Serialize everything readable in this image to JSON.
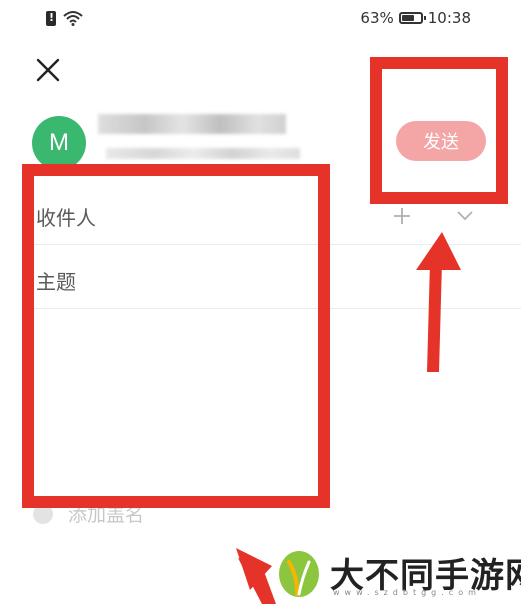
{
  "status_bar": {
    "battery_percent": "63%",
    "time": "10:38"
  },
  "compose": {
    "avatar_letter": "M",
    "send_label": "发送",
    "recipient_label": "收件人",
    "subject_label": "主题",
    "attach_label": "添加盖名"
  },
  "watermark": {
    "title": "大不同手游网",
    "url": "www.szdbtgg.com"
  },
  "colors": {
    "avatar": "#3bb86f",
    "send_button": "#f4a6a6",
    "annotation": "#e6332a"
  }
}
